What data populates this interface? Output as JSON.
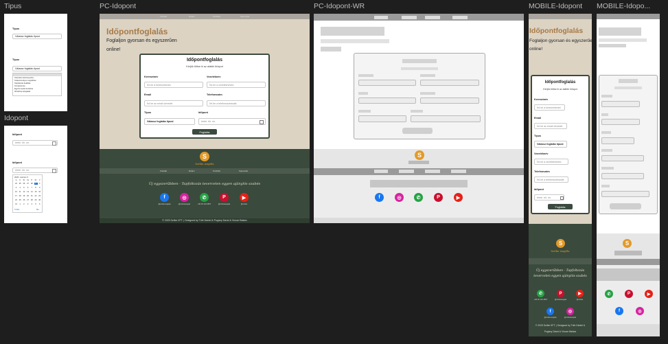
{
  "frames": {
    "tipus": "Tipus",
    "idopont": "Idopont",
    "pc": "PC-Idopont",
    "pc_wr": "PC-Idopont-WR",
    "mobile": "MOBILE-Idopont",
    "mobile_wr": "MOBILE-Idopo..."
  },
  "tipus_panel": {
    "label1": "Típus",
    "select1": "Válassz foglalás típust",
    "label2": "Típus",
    "select2": "Válassz foglalás típust",
    "options": [
      "Szerelési véleményezés",
      "Szakszemélyes megoldása",
      "Tapfoltozás beállítás",
      "Korrekció kés",
      "Egyéni esetek kezelése",
      "Workshop lefoglalás"
    ]
  },
  "idopont_panel": {
    "label1": "Időpont",
    "date_placeholder": "éééé. hh. nn.",
    "label2": "Időpont",
    "date_placeholder2": "éééé. hh. nn.",
    "calendar_month": "2025. március ▾",
    "weekdays": [
      "H",
      "K",
      "Sz",
      "Cs",
      "P",
      "Sz",
      "V"
    ],
    "days": [
      "24",
      "25",
      "26",
      "27",
      "28",
      "1",
      "2",
      "3",
      "4",
      "5",
      "6",
      "7",
      "8",
      "9",
      "10",
      "11",
      "12",
      "13",
      "14",
      "15",
      "16",
      "17",
      "18",
      "19",
      "20",
      "21",
      "22",
      "23",
      "24",
      "25",
      "26",
      "27",
      "28",
      "29",
      "30",
      "31",
      "1",
      "2",
      "3",
      "4",
      "5",
      "6"
    ],
    "today_index": 5,
    "clear_label": "Törlés",
    "today_label": "Ma"
  },
  "site": {
    "nav": [
      "Főoldal",
      "Rólam",
      "Portfólió",
      "Kapcsolat"
    ],
    "hero_title": "Időpontfoglalás",
    "hero_sub_line1": "Foglaljon gyorsan és egyszerűen",
    "hero_sub_line2": "online!",
    "form": {
      "title": "Időpontfoglalás",
      "subtitle": "Kérjük töltse ki az alábbi űrlapot",
      "first_name_label": "Keresztnév",
      "first_name_ph": "Írd be a keresztneved",
      "last_name_label": "Vezetéknév",
      "last_name_ph": "Írd be a vezetékneved",
      "email_label": "Email",
      "email_ph": "Írd be az email címedet",
      "phone_label": "Telefonszám",
      "phone_ph": "Írd be a telefonszámodat",
      "type_label": "Típus",
      "type_value": "Válassz foglalás típust",
      "date_label": "Időpont",
      "date_ph": "éééé. hh. nn.",
      "submit": "Foglalás"
    },
    "logo_text": "Szőke Angéla",
    "slogan": "Új egyszerűbben - Tapfoltozás tevercelen egyen ajánylós szabés",
    "socials": [
      {
        "name": "facebook",
        "handle": "@szoke.angela",
        "color": "#1877f2",
        "glyph": "f"
      },
      {
        "name": "instagram",
        "handle": "@szokeangela",
        "color": "#d6249f",
        "glyph": "◎"
      },
      {
        "name": "phone",
        "handle": "+36 30 123 4567",
        "color": "#25a244",
        "glyph": "✆"
      },
      {
        "name": "pinterest",
        "handle": "@szokeangela",
        "color": "#c8102e",
        "glyph": "P"
      },
      {
        "name": "youtube",
        "handle": "@szoke",
        "color": "#e62117",
        "glyph": "▶"
      }
    ],
    "footer_line1": "© 2025 Szőke KFT. | Designed by Tóth Dániel & Pogány Dávid & Vincze Balázs",
    "footer_mobile_1": "© 2025 Szőke KFT. | Designed by Tóth Dániel &",
    "footer_mobile_2": "Pogány Dávid & Vincze Balázs"
  },
  "colors": {
    "canvas": "#1e1e1e",
    "hero_bg": "#dcd3c3",
    "footer_bg": "#3a4a3c",
    "accent_brown": "#a77a47",
    "button_green": "#3b4a3e",
    "logo_orange": "#e39a2a"
  }
}
